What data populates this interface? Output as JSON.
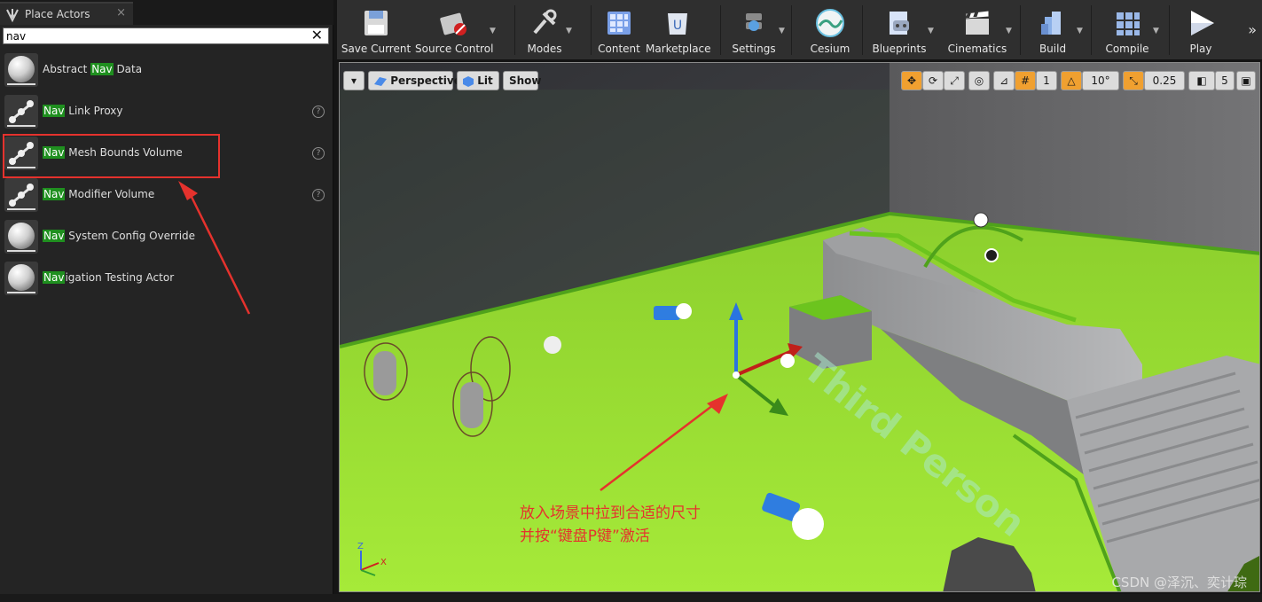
{
  "panel": {
    "tab_title": "Place Actors",
    "tab_close": "×",
    "search_value": "nav",
    "search_clear": "✕",
    "items": [
      {
        "pre": "Abstract ",
        "hl": "Nav",
        "post": " Data",
        "icon": "sphere-icon",
        "help": false
      },
      {
        "pre": "",
        "hl": "Nav",
        "post": " Link Proxy",
        "icon": "nav-link-proxy-icon",
        "help": true
      },
      {
        "pre": "",
        "hl": "Nav",
        "post": " Mesh Bounds Volume",
        "icon": "volume-icon",
        "help": true
      },
      {
        "pre": "",
        "hl": "Nav",
        "post": " Modifier Volume",
        "icon": "modifier-volume-icon",
        "help": true
      },
      {
        "pre": "",
        "hl": "Nav",
        "post": " System Config Override",
        "icon": "sphere-icon",
        "help": false
      },
      {
        "pre": "",
        "hl": "Nav",
        "post": "igation Testing Actor",
        "icon": "sphere-icon",
        "help": false
      }
    ],
    "help_glyph": "?"
  },
  "toolbar": {
    "buttons": [
      {
        "label": "Save Current",
        "icon": "save-icon"
      },
      {
        "label": "Source Control",
        "icon": "source-control-icon"
      },
      {
        "label": "Modes",
        "icon": "modes-icon"
      },
      {
        "label": "Content",
        "icon": "content-icon"
      },
      {
        "label": "Marketplace",
        "icon": "marketplace-icon"
      },
      {
        "label": "Settings",
        "icon": "settings-icon"
      },
      {
        "label": "Cesium",
        "icon": "cesium-icon"
      },
      {
        "label": "Blueprints",
        "icon": "blueprints-icon"
      },
      {
        "label": "Cinematics",
        "icon": "cinematics-icon"
      },
      {
        "label": "Build",
        "icon": "build-icon"
      },
      {
        "label": "Compile",
        "icon": "compile-icon"
      },
      {
        "label": "Play",
        "icon": "play-icon"
      }
    ],
    "more": "»"
  },
  "viewport": {
    "perspective_label": "Perspective",
    "lit_label": "Lit",
    "show_label": "Show",
    "grid_snap": "1",
    "rotation_snap": "10°",
    "scale_snap": "0.25",
    "camera_speed": "5",
    "floor_text": "Third Person",
    "annotation_line1": "放入场景中拉到合适的尺寸",
    "annotation_line2": "并按“键盘P键”激活",
    "watermark": "CSDN @泽沉、奕计琮",
    "axis_z": "Z",
    "axis_x": "X"
  },
  "colors": {
    "highlight": "#1f8f1f",
    "annotation_red": "#e5322d",
    "navmesh_green": "#9be42e",
    "snap_active": "#f0a030"
  }
}
